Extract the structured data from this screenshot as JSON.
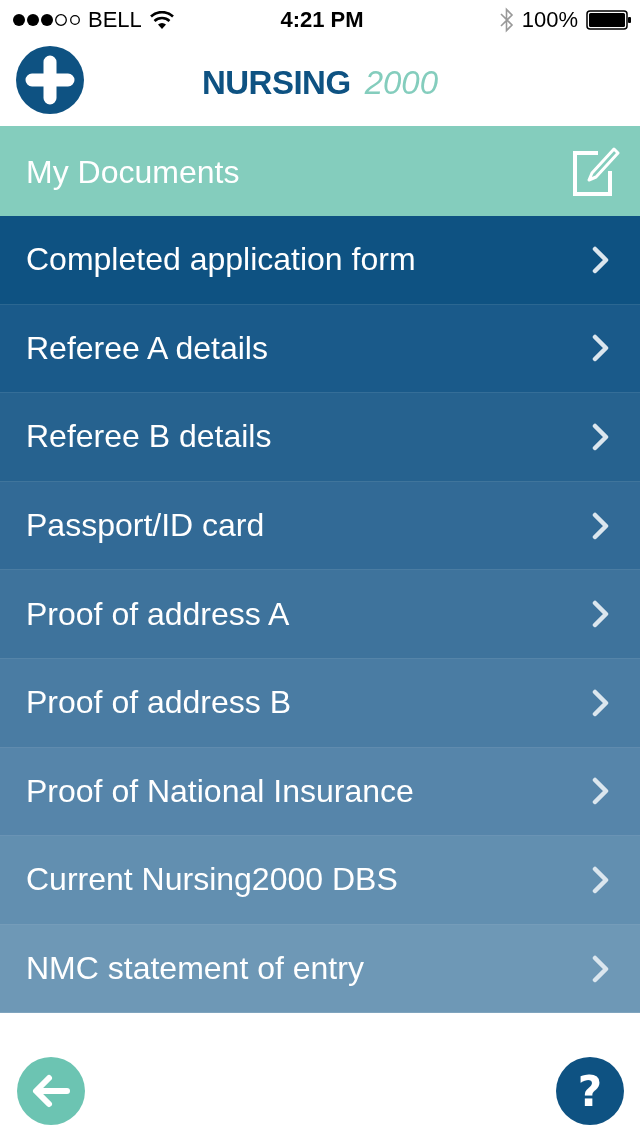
{
  "status_bar": {
    "carrier": "BELL",
    "time": "4:21 PM",
    "battery": "100%"
  },
  "header": {
    "brand": "NURSING",
    "brand_number": "2000"
  },
  "section": {
    "title": "My Documents"
  },
  "documents": [
    {
      "label": "Completed application form",
      "color": "#0e5282"
    },
    {
      "label": "Referee A details",
      "color": "#1a5a8a"
    },
    {
      "label": "Referee B details",
      "color": "#26628f"
    },
    {
      "label": "Passport/ID card",
      "color": "#326a96"
    },
    {
      "label": "Proof of address A",
      "color": "#3e739c"
    },
    {
      "label": "Proof of address B",
      "color": "#4a7ca3"
    },
    {
      "label": "Proof of National Insurance",
      "color": "#5685aa"
    },
    {
      "label": "Current Nursing2000 DBS",
      "color": "#628fb0"
    },
    {
      "label": "NMC statement of entry",
      "color": "#6e98b6"
    }
  ],
  "help_button": {
    "label": "?"
  }
}
